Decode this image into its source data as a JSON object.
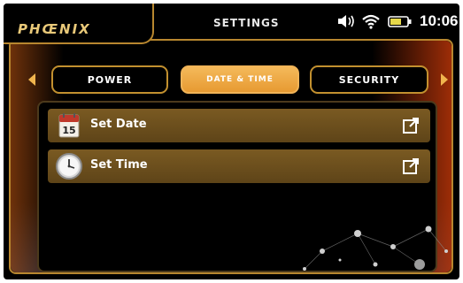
{
  "header": {
    "logo": "PHŒNIX",
    "title": "SETTINGS",
    "time": "10:06",
    "icons": [
      "volume-icon",
      "wifi-icon",
      "battery-icon"
    ]
  },
  "tabs": [
    {
      "label": "POWER",
      "active": false
    },
    {
      "label": "DATE & TIME",
      "active": true
    },
    {
      "label": "SECURITY",
      "active": false
    }
  ],
  "items": [
    {
      "label": "Set Date",
      "icon": "calendar-icon",
      "calendar_day": "15"
    },
    {
      "label": "Set Time",
      "icon": "clock-icon"
    }
  ],
  "colors": {
    "accent_gold": "#c2902f",
    "active_tab": "#efa843",
    "row_background": "#6b4e1d",
    "frame_glow": "#d23c0a"
  }
}
